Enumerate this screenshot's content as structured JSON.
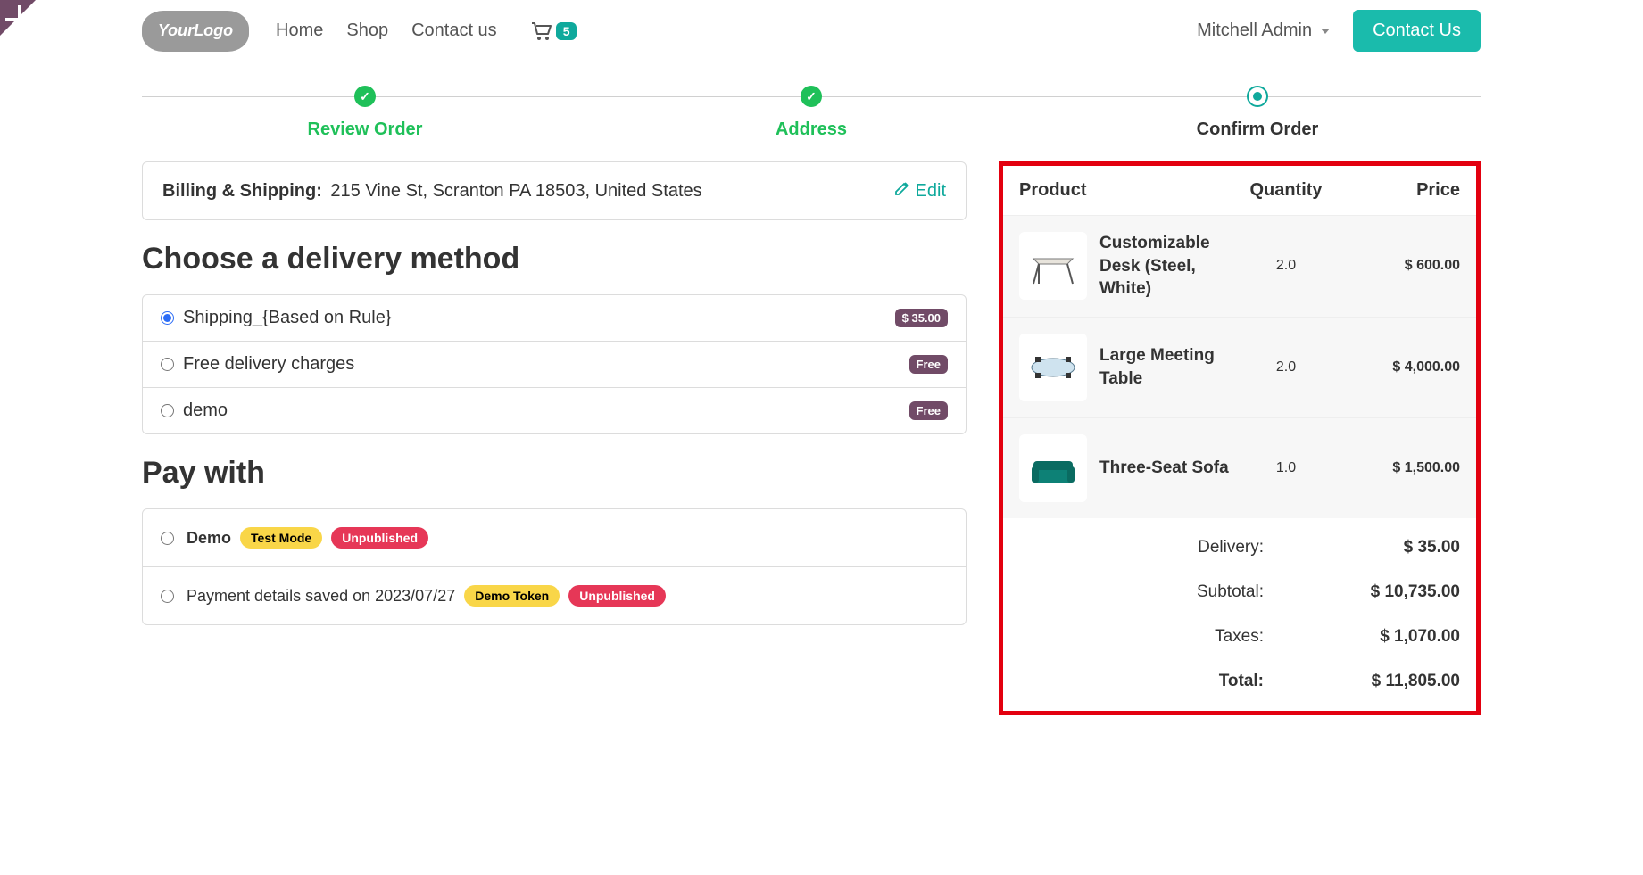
{
  "corner_ribbon": true,
  "nav": {
    "logo_text": "YourLogo",
    "items": [
      "Home",
      "Shop",
      "Contact us"
    ],
    "cart_count": "5",
    "user_name": "Mitchell Admin",
    "contact_button": "Contact Us"
  },
  "stepper": {
    "steps": [
      {
        "label": "Review Order",
        "state": "done"
      },
      {
        "label": "Address",
        "state": "done"
      },
      {
        "label": "Confirm Order",
        "state": "active"
      }
    ]
  },
  "address": {
    "heading": "Billing & Shipping:",
    "value": "215 Vine St, Scranton PA 18503, United States",
    "edit_label": "Edit"
  },
  "delivery": {
    "heading": "Choose a delivery method",
    "options": [
      {
        "label": "Shipping_{Based on Rule}",
        "price": "$ 35.00",
        "price_style": "amount",
        "selected": true
      },
      {
        "label": "Free delivery charges",
        "price": "Free",
        "price_style": "badge",
        "selected": false
      },
      {
        "label": "demo",
        "price": "Free",
        "price_style": "badge",
        "selected": false
      }
    ]
  },
  "payment": {
    "heading": "Pay with",
    "rows": [
      {
        "label": "Demo",
        "badges": [
          {
            "text": "Test Mode",
            "style": "yellow"
          },
          {
            "text": "Unpublished",
            "style": "red"
          }
        ],
        "selected": false,
        "strong": true
      },
      {
        "label": "Payment details saved on 2023/07/27",
        "badges": [
          {
            "text": "Demo Token",
            "style": "yellow"
          },
          {
            "text": "Unpublished",
            "style": "red"
          }
        ],
        "selected": false,
        "strong": false
      }
    ]
  },
  "summary": {
    "columns": {
      "product": "Product",
      "quantity": "Quantity",
      "price": "Price"
    },
    "lines": [
      {
        "name": "Customizable Desk (Steel, White)",
        "qty": "2.0",
        "price": "$ 600.00",
        "thumb": "desk"
      },
      {
        "name": "Large Meeting Table",
        "qty": "2.0",
        "price": "$ 4,000.00",
        "thumb": "table"
      },
      {
        "name": "Three-Seat Sofa",
        "qty": "1.0",
        "price": "$ 1,500.00",
        "thumb": "sofa"
      }
    ],
    "totals": [
      {
        "label": "Delivery:",
        "value": "$ 35.00",
        "strong": false
      },
      {
        "label": "Subtotal:",
        "value": "$ 10,735.00",
        "strong": false
      },
      {
        "label": "Taxes:",
        "value": "$ 1,070.00",
        "strong": false
      },
      {
        "label": "Total:",
        "value": "$ 11,805.00",
        "strong": true
      }
    ]
  }
}
